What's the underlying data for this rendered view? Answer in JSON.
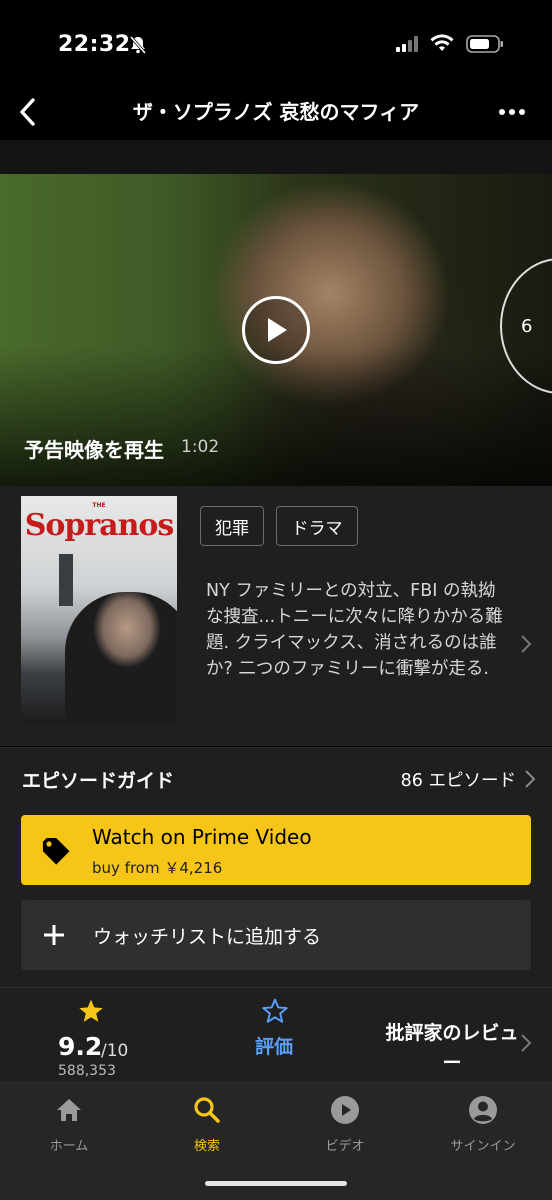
{
  "status_bar": {
    "time": "22:32"
  },
  "nav": {
    "title": "ザ・ソプラノズ 哀愁のマフィア"
  },
  "hero": {
    "trailer_label": "予告映像を再生",
    "trailer_duration": "1:02",
    "side_number": "6"
  },
  "poster": {
    "the": "THE",
    "title": "Sopranos"
  },
  "genres": [
    "犯罪",
    "ドラマ"
  ],
  "synopsis": "NY ファミリーとの対立、FBI の執拗な捜査...トニーに次々に降りかかる難題. クライマックス、消されるのは誰か? 二つのファミリーに衝撃が走る.",
  "episodes": {
    "title": "エピソードガイド",
    "count": "86 エピソード"
  },
  "prime": {
    "title": "Watch on Prime Video",
    "subtitle": "buy from ￥4,216"
  },
  "watchlist": {
    "label": "ウォッチリストに追加する"
  },
  "rating": {
    "score": "9.2",
    "out_of": "/10",
    "count": "588,353",
    "rate_label": "評価",
    "critic_label": "批評家のレビュー"
  },
  "tabs": [
    {
      "label": "ホーム",
      "icon": "home-icon"
    },
    {
      "label": "検索",
      "icon": "search-icon"
    },
    {
      "label": "ビデオ",
      "icon": "play-circle-icon"
    },
    {
      "label": "サインイン",
      "icon": "account-icon"
    }
  ],
  "colors": {
    "accent": "#f5c518",
    "rate_blue": "#5a9ff5",
    "background": "#1f1f1f"
  }
}
